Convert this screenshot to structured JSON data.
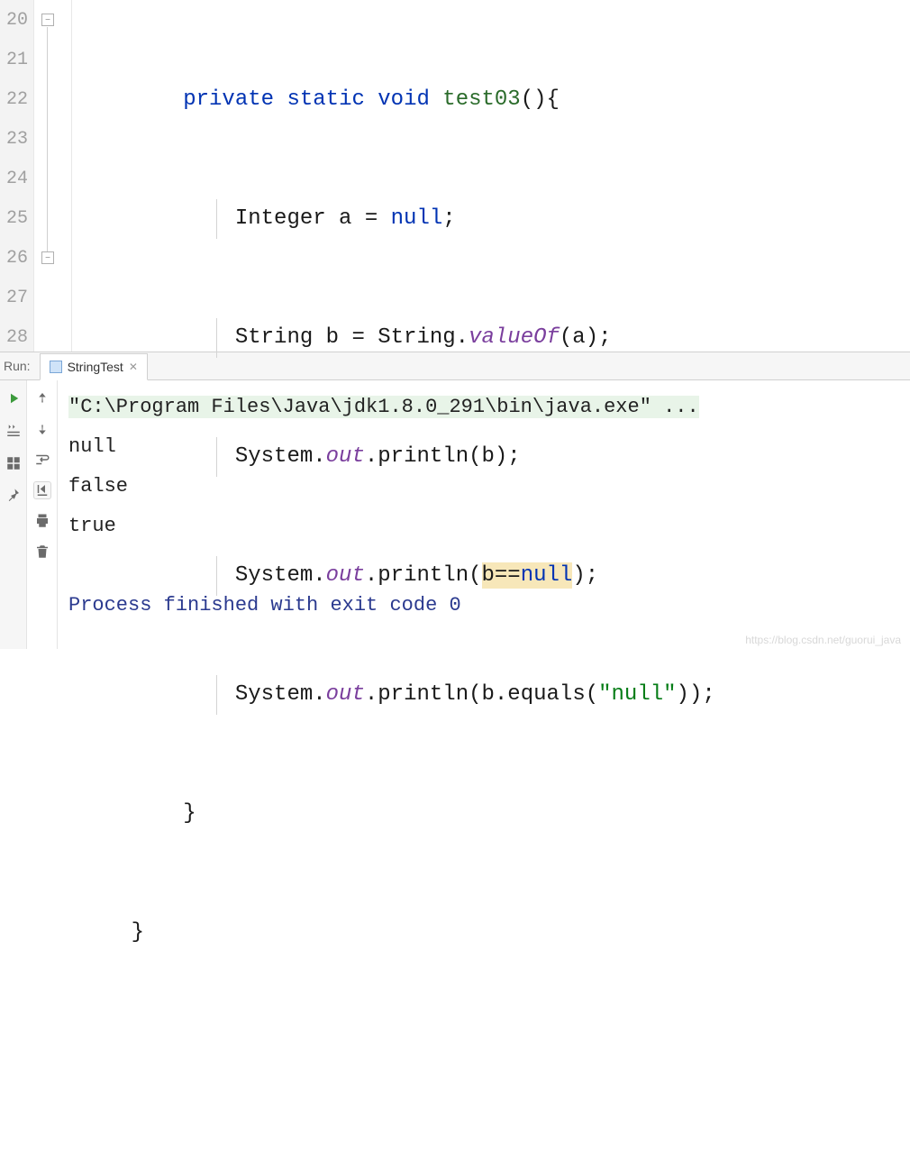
{
  "gutter": [
    "20",
    "21",
    "22",
    "23",
    "24",
    "25",
    "26",
    "27",
    "28"
  ],
  "code": {
    "l20": {
      "kw1": "private",
      "kw2": "static",
      "kw3": "void",
      "fn": "test03",
      "tail": "(){"
    },
    "l21": {
      "pre": "            Integer a = ",
      "kw": "null",
      "tail": ";"
    },
    "l22": {
      "pre": "            String b = String.",
      "it": "valueOf",
      "tail": "(a);"
    },
    "l23": {
      "pre": "            System.",
      "it": "out",
      "tail": ".println(b);"
    },
    "l24": {
      "pre": "            System.",
      "it": "out",
      "mid": ".println(",
      "hlA": "b==",
      "hlKw": "null",
      "tail": ");"
    },
    "l25": {
      "pre": "            System.",
      "it": "out",
      "mid": ".println(b.equals(",
      "str": "\"null\"",
      "tail": "));"
    },
    "l26": "        }",
    "l27": "    }"
  },
  "run": {
    "panel_label": "Run:",
    "tab_label": "StringTest",
    "cmd": "\"C:\\Program Files\\Java\\jdk1.8.0_291\\bin\\java.exe\" ...",
    "out": [
      "null",
      "false",
      "true",
      ""
    ],
    "exit": "Process finished with exit code 0"
  },
  "watermark": "https://blog.csdn.net/guorui_java"
}
